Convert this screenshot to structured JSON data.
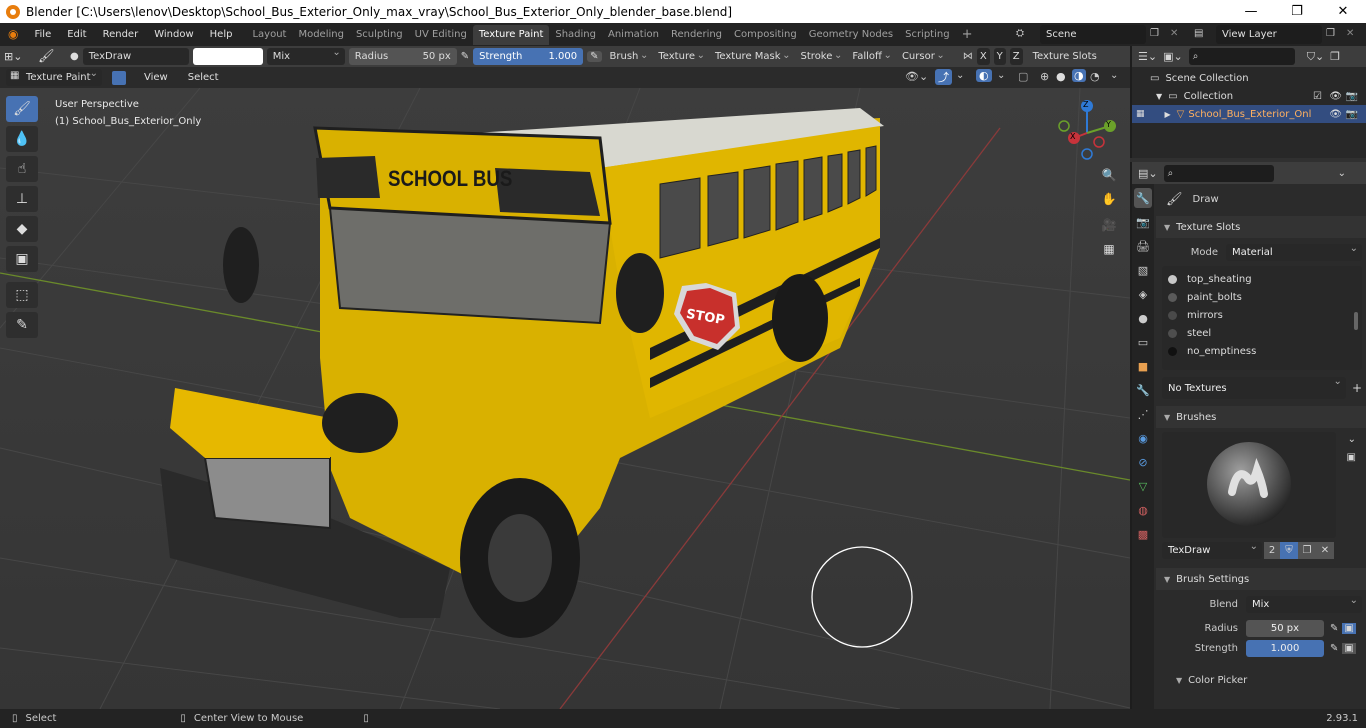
{
  "window": {
    "title": "Blender [C:\\Users\\lenov\\Desktop\\School_Bus_Exterior_Only_max_vray\\School_Bus_Exterior_Only_blender_base.blend]",
    "minimize": "—",
    "maximize": "❐",
    "close": "✕"
  },
  "menu": [
    "File",
    "Edit",
    "Render",
    "Window",
    "Help"
  ],
  "workspaces": [
    "Layout",
    "Modeling",
    "Sculpting",
    "UV Editing",
    "Texture Paint",
    "Shading",
    "Animation",
    "Rendering",
    "Compositing",
    "Geometry Nodes",
    "Scripting"
  ],
  "active_workspace": "Texture Paint",
  "scene": {
    "name": "Scene",
    "view_layer": "View Layer"
  },
  "tool_header": {
    "brush_name": "TexDraw",
    "blend": "Mix",
    "radius_label": "Radius",
    "radius_value": "50 px",
    "strength_label": "Strength",
    "strength_value": "1.000",
    "menus": [
      "Brush",
      "Texture",
      "Texture Mask",
      "Stroke",
      "Falloff",
      "Cursor"
    ],
    "axes": [
      "X",
      "Y",
      "Z"
    ],
    "texture_slots": "Texture Slots"
  },
  "viewport_header": {
    "mode": "Texture Paint",
    "menus": [
      "View",
      "Select"
    ]
  },
  "viewport": {
    "perspective": "User Perspective",
    "object": "(1) School_Bus_Exterior_Only",
    "bus_sign": "SCHOOL BUS",
    "stop_sign": "STOP"
  },
  "gizmo": {
    "x": "X",
    "y": "Y",
    "z": "Z"
  },
  "outliner": {
    "scene_collection": "Scene Collection",
    "collection": "Collection",
    "object": "School_Bus_Exterior_Onl"
  },
  "properties": {
    "tool": "Draw",
    "texture_slots_title": "Texture Slots",
    "mode_label": "Mode",
    "mode_value": "Material",
    "slots": [
      "top_sheating",
      "paint_bolts",
      "mirrors",
      "steel",
      "no_emptiness"
    ],
    "no_textures": "No Textures",
    "brushes_title": "Brushes",
    "brush_name": "TexDraw",
    "brush_users": "2",
    "brush_settings_title": "Brush Settings",
    "blend_label": "Blend",
    "blend_value": "Mix",
    "radius_label": "Radius",
    "radius_value": "50 px",
    "strength_label": "Strength",
    "strength_value": "1.000",
    "color_picker": "Color Picker"
  },
  "status": {
    "select": "Select",
    "center_view": "Center View to Mouse",
    "version": "2.93.1"
  }
}
